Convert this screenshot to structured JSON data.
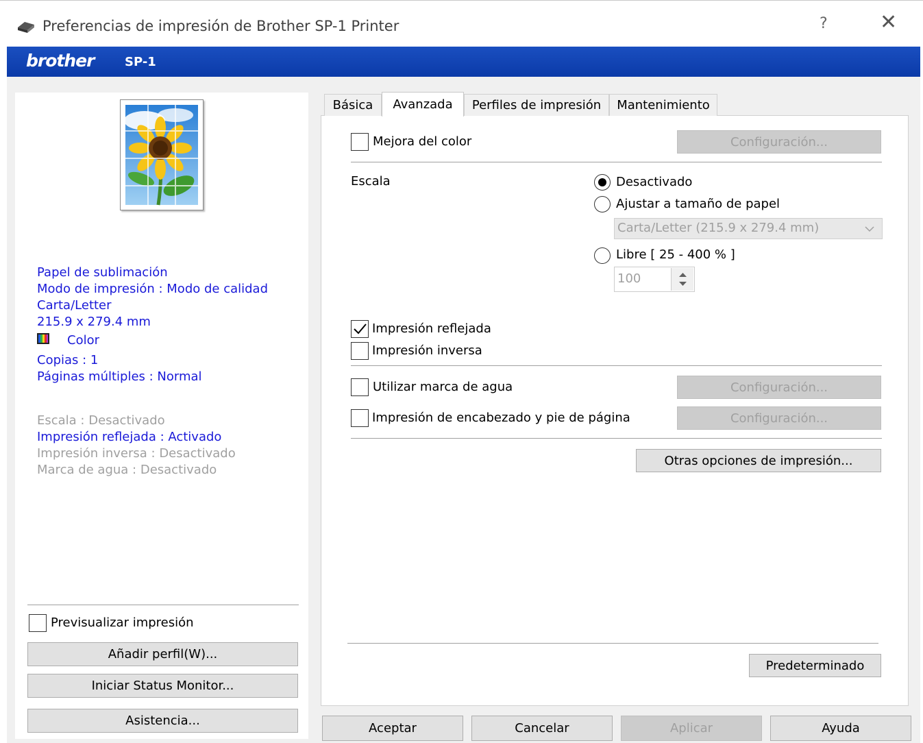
{
  "window": {
    "title": "Preferencias de impresión de Brother SP-1 Printer",
    "help": "?",
    "close": "✕",
    "brand": "brother",
    "model": "SP-1"
  },
  "summary": {
    "paper": "Papel de sublimación",
    "mode": "Modo de impresión : Modo de calidad",
    "size_name": "Carta/Letter",
    "size_dim": "215.9 x 279.4 mm",
    "color": "Color",
    "copies": "Copias : 1",
    "pages": "Páginas múltiples : Normal",
    "scale": "Escala : Desactivado",
    "mirror": "Impresión reflejada : Activado",
    "reverse": "Impresión inversa : Desactivado",
    "watermark": "Marca de agua : Desactivado"
  },
  "left_controls": {
    "preview_label": "Previsualizar impresión",
    "add_profile": "Añadir perfil(W)...",
    "status_monitor": "Iniciar Status Monitor...",
    "support": "Asistencia..."
  },
  "tabs": [
    "Básica",
    "Avanzada",
    "Perfiles de impresión",
    "Mantenimiento"
  ],
  "advanced": {
    "color_enhance": "Mejora del color",
    "config": "Configuración...",
    "scale_label": "Escala",
    "scale_off": "Desactivado",
    "fit_paper": "Ajustar a tamaño de papel",
    "paper_select": "Carta/Letter (215.9 x 279.4 mm)",
    "free": "Libre [ 25 - 400 % ]",
    "free_value": "100",
    "mirror": "Impresión reflejada",
    "reverse": "Impresión inversa",
    "watermark": "Utilizar marca de agua",
    "header_footer": "Impresión de encabezado y pie de página",
    "other_options": "Otras opciones de impresión...",
    "default": "Predeterminado"
  },
  "footer": {
    "ok": "Aceptar",
    "cancel": "Cancelar",
    "apply": "Aplicar",
    "help": "Ayuda"
  }
}
